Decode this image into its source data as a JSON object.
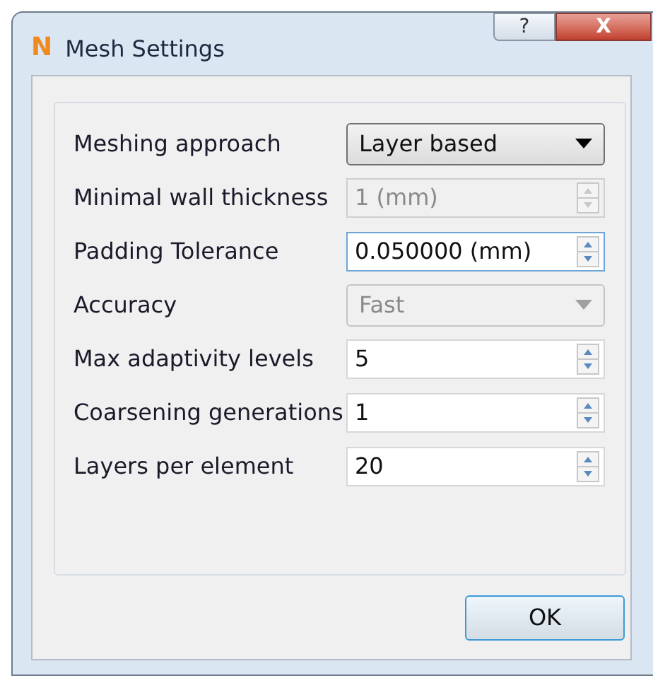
{
  "window": {
    "title": "Mesh Settings",
    "app_icon": "N",
    "help_glyph": "?",
    "close_glyph": "X"
  },
  "fields": [
    {
      "label": "Meshing approach",
      "kind": "combo",
      "value": "Layer based",
      "disabled": false
    },
    {
      "label": "Minimal wall thickness",
      "kind": "spin",
      "value": "1 (mm)",
      "disabled": true
    },
    {
      "label": "Padding Tolerance",
      "kind": "spin",
      "value": "0.050000 (mm)",
      "disabled": false,
      "focused": true
    },
    {
      "label": "Accuracy",
      "kind": "combo",
      "value": "Fast",
      "disabled": true
    },
    {
      "label": "Max adaptivity levels",
      "kind": "spin",
      "value": "5",
      "disabled": false,
      "focused": false
    },
    {
      "label": "Coarsening generations",
      "kind": "spin",
      "value": "1",
      "disabled": false,
      "focused": false
    },
    {
      "label": "Layers per element",
      "kind": "spin",
      "value": "20",
      "disabled": false,
      "focused": false
    }
  ],
  "buttons": [
    {
      "label": "OK"
    }
  ]
}
